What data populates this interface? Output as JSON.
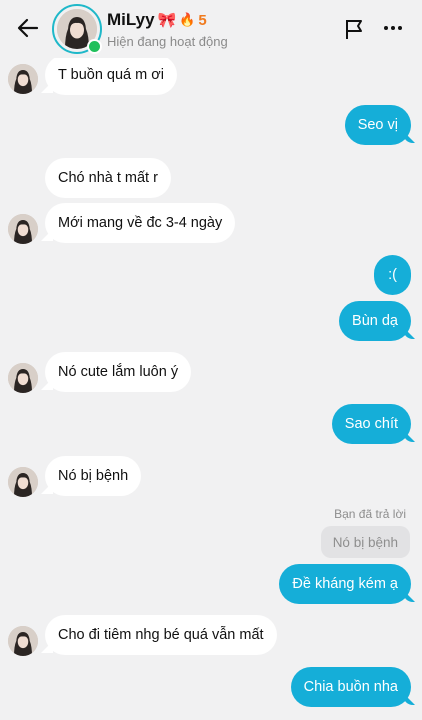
{
  "header": {
    "contact_name": "MiLyy",
    "name_emoji": "🎀",
    "streak_icon": "🔥",
    "streak_count": "5",
    "status": "Hiện đang hoạt động"
  },
  "messages": [
    {
      "side": "in",
      "text": "T buồn quá m ơi"
    },
    {
      "side": "out",
      "text": "Seo vị"
    },
    {
      "side": "in",
      "text": "Chó nhà t mất r"
    },
    {
      "side": "in",
      "text": "Mới mang về đc 3-4 ngày"
    },
    {
      "side": "out",
      "text": ":("
    },
    {
      "side": "out",
      "text": "Bùn dạ"
    },
    {
      "side": "in",
      "text": "Nó cute lắm luôn ý"
    },
    {
      "side": "out",
      "text": "Sao chít"
    },
    {
      "side": "in",
      "text": "Nó bị bệnh"
    },
    {
      "side": "out",
      "text": "Đề kháng kém ạ"
    },
    {
      "side": "in",
      "text": "Cho đi tiêm nhg bé quá vẫn mất"
    },
    {
      "side": "out",
      "text": "Chia buồn nha"
    }
  ],
  "reply": {
    "label": "Bạn đã trả lời",
    "quoted_text": "Nó bị bệnh"
  },
  "colors": {
    "background": "#f1f1f2",
    "outgoing_bubble": "#15aed8",
    "incoming_bubble": "#ffffff",
    "online": "#20c05c",
    "avatar_ring": "#1fb8c9"
  },
  "icons": {
    "back": "arrow-left-icon",
    "flag": "flag-icon",
    "more": "more-horizontal-icon"
  }
}
